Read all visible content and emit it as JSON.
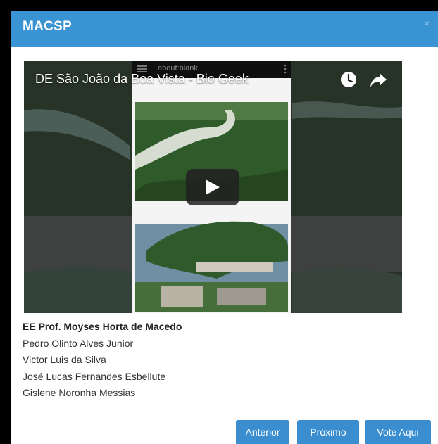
{
  "modal": {
    "title": "MACSP",
    "close_label": "×"
  },
  "video": {
    "title": "DE São João da Boa Vista - Bio Geek",
    "url_text": "about:blank"
  },
  "info": {
    "school": "EE Prof. Moyses Horta de Macedo",
    "members": [
      "Pedro Olinto Alves Junior",
      "Victor Luis da Silva",
      "José Lucas Fernandes Esbellute",
      "Gislene Noronha Messias"
    ]
  },
  "footer": {
    "prev_label": "Anterior",
    "next_label": "Próximo",
    "vote_label": "Vote Aqui"
  },
  "colors": {
    "header": "#3a93d3",
    "button": "#3a8ed0"
  }
}
